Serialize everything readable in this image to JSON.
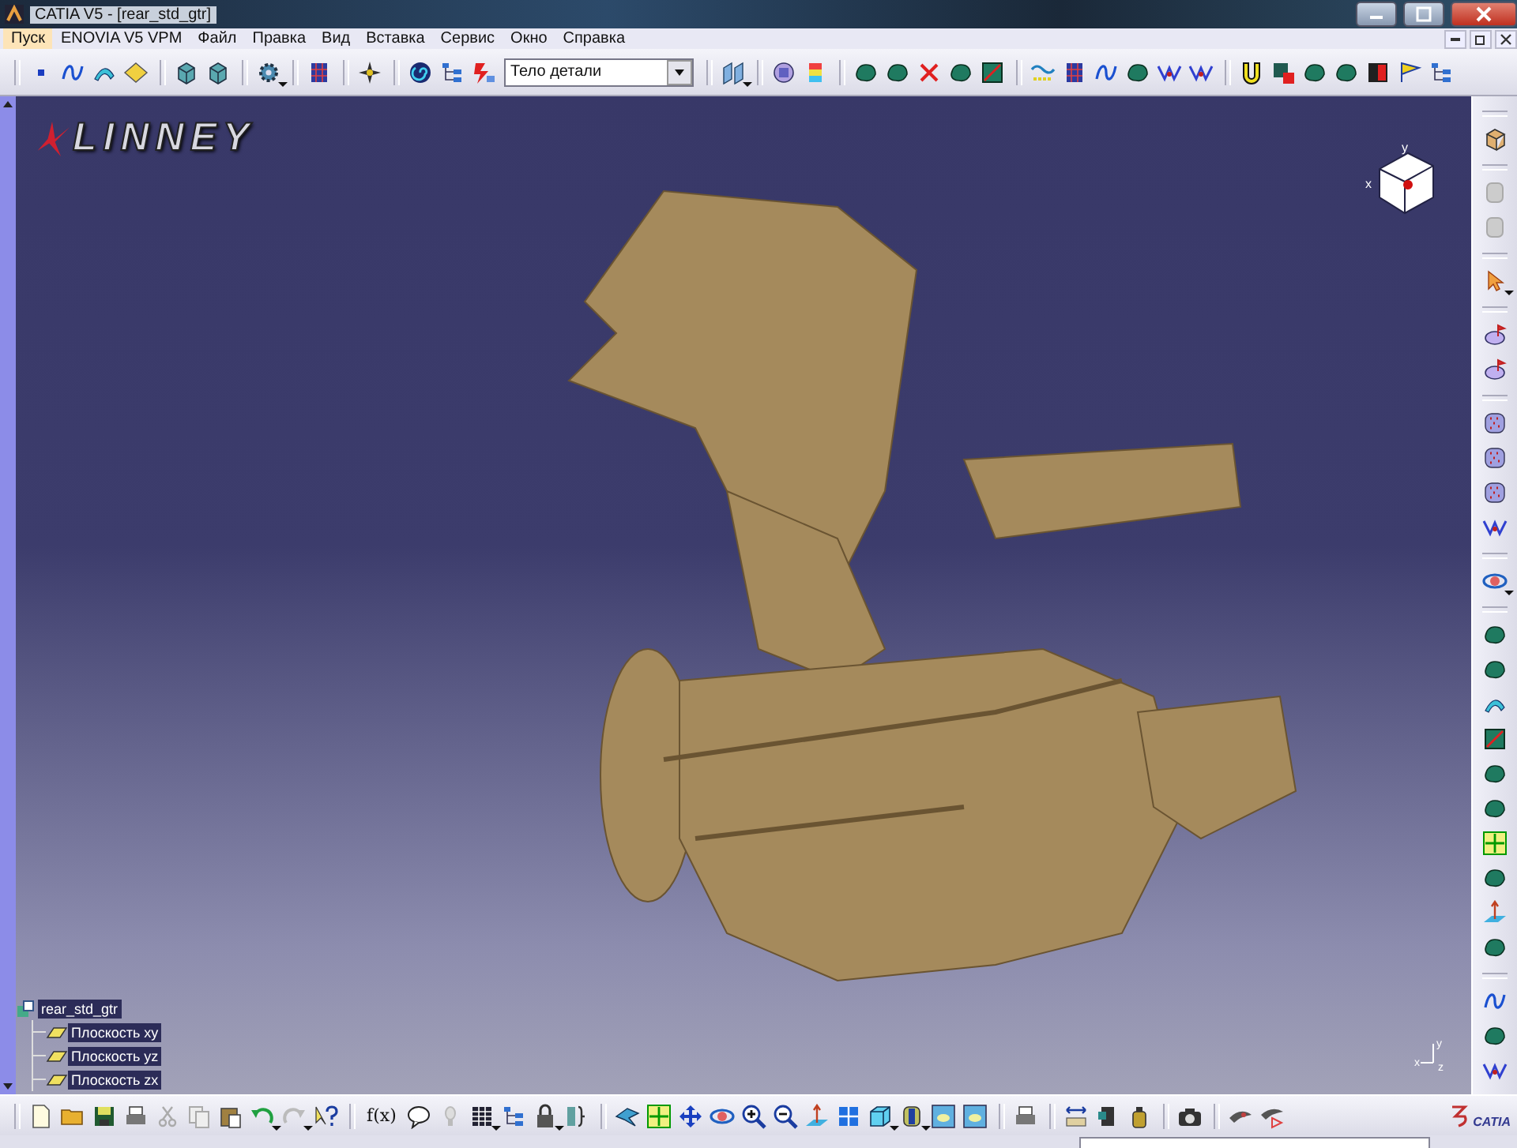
{
  "window": {
    "title": "CATIA V5 - [rear_std_gtr]"
  },
  "menu": [
    {
      "label": "Пуск",
      "selected": true
    },
    {
      "label": "ENOVIA V5 VPM",
      "selected": false
    },
    {
      "label": "Файл",
      "selected": false
    },
    {
      "label": "Правка",
      "selected": false
    },
    {
      "label": "Вид",
      "selected": false
    },
    {
      "label": "Вставка",
      "selected": false
    },
    {
      "label": "Сервис",
      "selected": false
    },
    {
      "label": "Окно",
      "selected": false
    },
    {
      "label": "Справка",
      "selected": false
    }
  ],
  "toolbar": {
    "body_select": {
      "value": "Тело детали"
    }
  },
  "viewport": {
    "logo": "LINNEY",
    "compass_labels": [
      "y",
      "x"
    ],
    "axis_labels": [
      "y",
      "x",
      "z"
    ],
    "tree": {
      "label": "rear_std_gtr",
      "selected": true,
      "children": [
        {
          "label": "Плоскость xy",
          "selected": true
        },
        {
          "label": "Плоскость yz",
          "selected": true
        },
        {
          "label": "Плоскость zx",
          "selected": true
        }
      ]
    }
  },
  "bottom_toolbar": {
    "formula_label": "f(x)"
  },
  "brand": "CATIA"
}
